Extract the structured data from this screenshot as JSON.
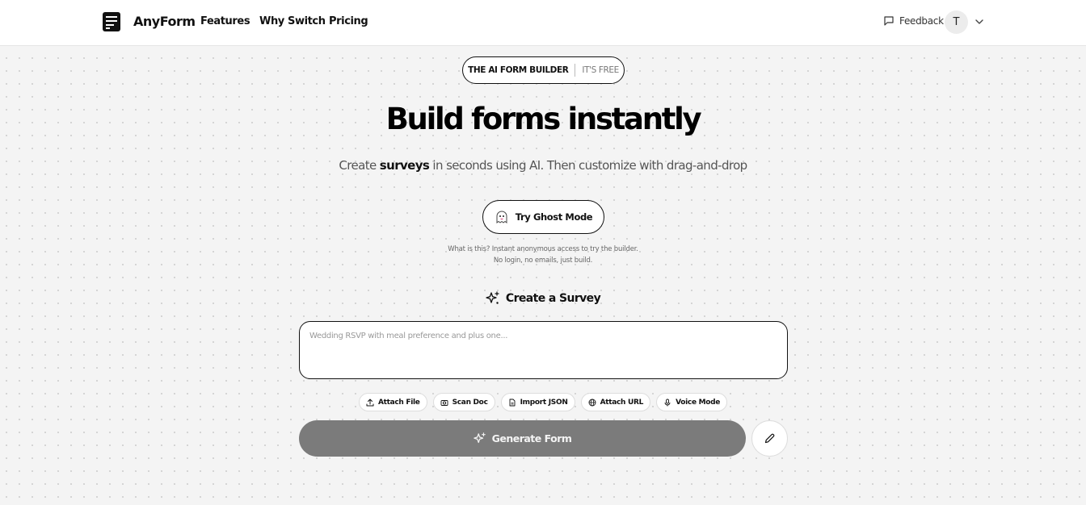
{
  "header": {
    "brand": "AnyForm",
    "nav": [
      "Features",
      "Why Switch",
      "Pricing"
    ],
    "feedback": "Feedback",
    "avatar_initial": "T"
  },
  "hero": {
    "badge_primary": "THE AI FORM BUILDER",
    "badge_secondary": "IT'S FREE",
    "title": "Build forms instantly",
    "subtitle_pre": "Create ",
    "subtitle_bold": "surveys",
    "subtitle_post": " in seconds using AI. Then customize with drag-and-drop"
  },
  "ghost": {
    "button_label": "Try Ghost Mode",
    "note_line1": "What is this? Instant anonymous access to try the builder.",
    "note_line2": "No login, no emails, just build."
  },
  "create": {
    "title": "Create a Survey",
    "placeholder": "Wedding RSVP with meal preference and plus one...",
    "value": ""
  },
  "chips": [
    {
      "label": "Attach File",
      "icon": "upload-icon"
    },
    {
      "label": "Scan Doc",
      "icon": "camera-icon"
    },
    {
      "label": "Import JSON",
      "icon": "file-icon"
    },
    {
      "label": "Attach URL",
      "icon": "globe-icon"
    },
    {
      "label": "Voice Mode",
      "icon": "mic-icon"
    }
  ],
  "actions": {
    "generate_label": "Generate Form",
    "edit_icon": "pencil-icon"
  },
  "colors": {
    "background": "#f4f4f4",
    "generate_button": "#7b7b7b",
    "border": "#111111"
  }
}
